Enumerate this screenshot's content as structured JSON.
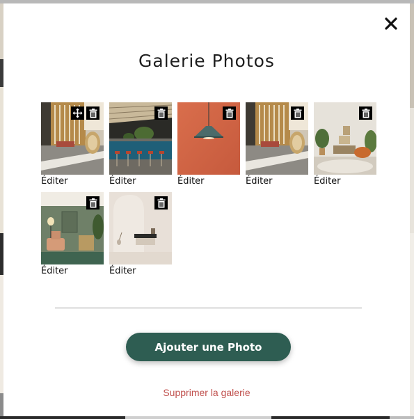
{
  "modal": {
    "title": "Galerie Photos",
    "close_icon": "close-icon",
    "photos": [
      {
        "edit_label": "Éditer",
        "scene": "room-rattan-chair",
        "has_move_icon": true
      },
      {
        "edit_label": "Éditer",
        "scene": "bar-counter",
        "has_move_icon": false
      },
      {
        "edit_label": "Éditer",
        "scene": "pendant-lamp",
        "has_move_icon": false
      },
      {
        "edit_label": "Éditer",
        "scene": "room-rattan-chair",
        "has_move_icon": false
      },
      {
        "edit_label": "Éditer",
        "scene": "living-room-plants",
        "has_move_icon": false
      },
      {
        "edit_label": "Éditer",
        "scene": "green-wall-lounge",
        "has_move_icon": false
      },
      {
        "edit_label": "Éditer",
        "scene": "white-arch-room",
        "has_move_icon": false
      }
    ],
    "add_button_label": "Ajouter une Photo",
    "delete_gallery_label": "Supprimer la galerie",
    "colors": {
      "primary_button": "#2e5d52",
      "danger_text": "#c0504d",
      "icon_background": "#000000"
    }
  }
}
